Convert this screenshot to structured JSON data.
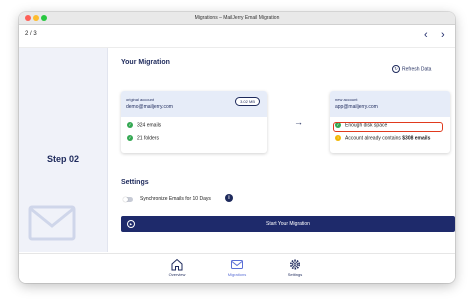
{
  "window": {
    "title": "Migrations – MailJerry Email Migration"
  },
  "toolbar": {
    "pager": "2 / 3",
    "back": "‹",
    "forward": "›"
  },
  "sidebar": {
    "step": "Step 02"
  },
  "migration": {
    "heading": "Your Migration",
    "refresh": "Refresh Data",
    "arrow": "→",
    "source": {
      "label": "original account",
      "email": "demo@mailjerry.com",
      "size": "3.02 MB",
      "stats": [
        "324 emails",
        "21 folders"
      ]
    },
    "target": {
      "label": "new account",
      "email": "app@mailjerry.com",
      "checks": [
        {
          "status": "ok",
          "prefix": "Enough disk space",
          "bold": ""
        },
        {
          "status": "warning",
          "prefix": "Account already contains ",
          "bold": "$308 emails"
        }
      ]
    }
  },
  "settings": {
    "heading": "Settings",
    "sync_label": "Synchronize Emails for 10 Days",
    "sync_enabled": false,
    "info": "i",
    "start_label": "Start Your Migration"
  },
  "tabs": [
    {
      "label": "Overview",
      "icon": "home-icon",
      "active": false
    },
    {
      "label": "Migrations",
      "icon": "mail-icon",
      "active": true
    },
    {
      "label": "Settings",
      "icon": "gear-icon",
      "active": false
    }
  ],
  "colors": {
    "accent": "#1e2a6b",
    "highlight": "#e03a1e",
    "success": "#34a853",
    "warning": "#f2b705"
  }
}
